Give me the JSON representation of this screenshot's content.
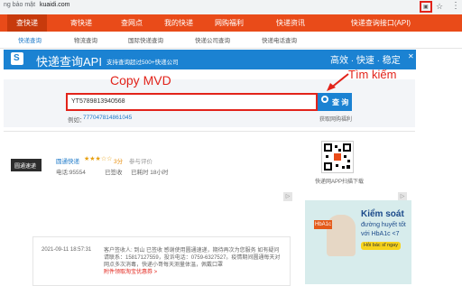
{
  "browser": {
    "security_text": "ng bảo mật",
    "url": "kuaidi.com"
  },
  "nav": [
    "查快递",
    "寄快递",
    "查网点",
    "我的快递",
    "网购福利",
    "快递资讯",
    "快递查询接口(API)"
  ],
  "subnav": [
    "快递查询",
    "物流查询",
    "国际快递查询",
    "快递公司查询",
    "快递电话查询"
  ],
  "banner": {
    "title": "快递查询API",
    "subtitle": "支持查询超过500+快递公司",
    "right": "高效 · 快速 · 稳定"
  },
  "annotations": {
    "copy": "Copy MVD",
    "tim": "Tìm kiếm"
  },
  "search": {
    "value": "YT5789813940568",
    "button_label": "查 询",
    "history_label": "例如：",
    "history_value": "777047814861045",
    "right_link": "获取网购福利"
  },
  "result": {
    "logo_text": "圆通速递",
    "company": "圆通快递",
    "stars": "★★★☆☆",
    "score": "3分",
    "review": "参与评价",
    "phone": "电话:95554",
    "status": "已签收",
    "used": "已耗时 18小时",
    "qr_label": "快递网APP扫描下载"
  },
  "log": {
    "time": "2021-09-11 18:57:31",
    "text": "客户签收人: 到山 已签收 感谢使用圆通速递，期待再次为您服务 如有疑问请联系：15817127559，投诉电话：0759-6327527。疫情期间圆通每天对网点多次消毒，快递小哥每天测量体温，佩戴口罩",
    "link": "附件领取淘宝优惠券 >"
  },
  "ad": {
    "title": "Kiểm soát",
    "sub1": "đường huyết tốt",
    "sub2": "với HbA1c <7",
    "tag": "HbA1c",
    "button": "Hỏi bác sĩ ngay"
  }
}
